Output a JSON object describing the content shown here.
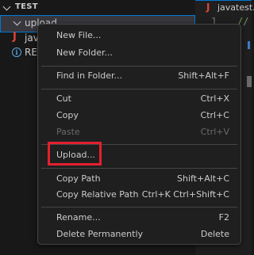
{
  "explorer": {
    "section_title": "TEST",
    "items": [
      {
        "label": "upload",
        "type": "folder"
      },
      {
        "label": "java",
        "type": "java-file"
      },
      {
        "label": "REA",
        "type": "info-file"
      }
    ]
  },
  "editor": {
    "tab_label": "javatest.ja",
    "line_number": "1",
    "code_fragment": "//"
  },
  "context_menu": {
    "items": [
      {
        "label": "New File...",
        "shortcut": ""
      },
      {
        "label": "New Folder...",
        "shortcut": ""
      },
      {
        "label": "Find in Folder...",
        "shortcut": "Shift+Alt+F"
      },
      {
        "label": "Cut",
        "shortcut": "Ctrl+X"
      },
      {
        "label": "Copy",
        "shortcut": "Ctrl+C"
      },
      {
        "label": "Paste",
        "shortcut": "Ctrl+V",
        "disabled": true
      },
      {
        "label": "Upload...",
        "shortcut": "",
        "highlighted": true
      },
      {
        "label": "Copy Path",
        "shortcut": "Shift+Alt+C"
      },
      {
        "label": "Copy Relative Path",
        "shortcut": "Ctrl+K Ctrl+Shift+C"
      },
      {
        "label": "Rename...",
        "shortcut": "F2"
      },
      {
        "label": "Delete Permanently",
        "shortcut": "Delete"
      }
    ]
  },
  "colors": {
    "highlight_border": "#e4202e",
    "java_icon": "#e0443e",
    "selection_outline": "#0078d4"
  }
}
